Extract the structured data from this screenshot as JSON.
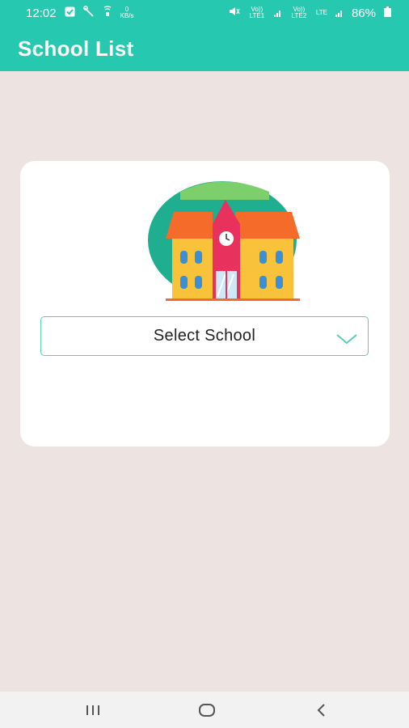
{
  "status_bar": {
    "time": "12:02",
    "data_speed_value": "0",
    "data_speed_unit": "KB/s",
    "signal_1_label": "Vo)) LTE1",
    "signal_2_label": "Vo)) LTE2",
    "lte_label": "LTE",
    "battery": "86%"
  },
  "app_bar": {
    "title": "School List"
  },
  "card": {
    "illustration": "school-building-icon",
    "dropdown": {
      "selected": "Select School"
    }
  },
  "nav_bar": {
    "recents_icon": "recents-icon",
    "home_icon": "home-icon",
    "back_icon": "back-icon"
  },
  "colors": {
    "primary": "#26c9b0",
    "background": "#ede3e1",
    "card": "#ffffff",
    "dropdown_border": "#5fc9b8"
  }
}
